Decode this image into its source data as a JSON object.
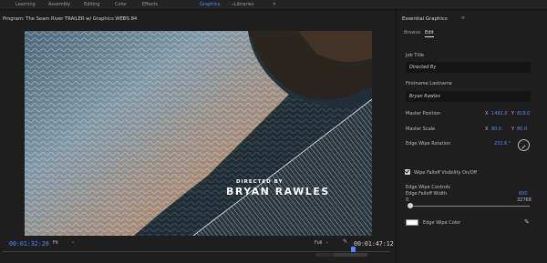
{
  "topbar": {
    "workspaces": [
      "Learning",
      "Assembly",
      "Editing",
      "Color",
      "Effects",
      "Graphics",
      "Libraries"
    ],
    "active": "Graphics",
    "more_glyph": "»"
  },
  "program": {
    "title": "Program: The Seam River TRAILER w/ Graphics WEDS 84",
    "menu_glyph": "≡",
    "overlay_small": "DIRECTED BY",
    "overlay_large": "BRYAN RAWLES",
    "timecode_current": "00:01:32:20",
    "timecode_end": "00:01:47:12",
    "zoom": "Fit",
    "resolution": "Full",
    "icons": [
      "wrench-icon",
      "add-marker-icon",
      "mark-in-icon",
      "mark-out-icon",
      "go-to-in-icon",
      "step-back-icon",
      "play-icon",
      "step-forward-icon",
      "go-to-out-icon",
      "lift-icon",
      "extract-icon",
      "export-frame-icon",
      "comparison-icon",
      "button-editor-icon"
    ]
  },
  "essential_graphics": {
    "title": "Essential Graphics",
    "menu_glyph": "≡",
    "tabs": [
      "Browse",
      "Edit"
    ],
    "active_tab": "Edit",
    "job_title_label": "Job Title",
    "job_title_value": "Directed By",
    "name_label": "Firstname Lastname",
    "name_value": "Bryan Rawles",
    "master_position_label": "Master Position",
    "master_position_x": "1492.0",
    "master_position_y": "818.0",
    "master_scale_label": "Master Scale",
    "master_scale_x": "80.0",
    "master_scale_y": "80.0",
    "edge_wipe_rotation_label": "Edge Wipe Rotation",
    "edge_wipe_rotation_value": "232.6 °",
    "wipe_falloff_label": "Wipe Falloff Visibility On/Off",
    "wipe_falloff_checked": true,
    "edge_wipe_controls_label": "Edge Wipe Controls",
    "edge_falloff_width_label": "Edge Falloff Width",
    "edge_falloff_width_value": "600",
    "slider_min": "0",
    "slider_max": "32768",
    "edge_wipe_color_label": "Edge Wipe Color",
    "swatch_color": "#ffffff",
    "accent": "#4f8cff"
  }
}
